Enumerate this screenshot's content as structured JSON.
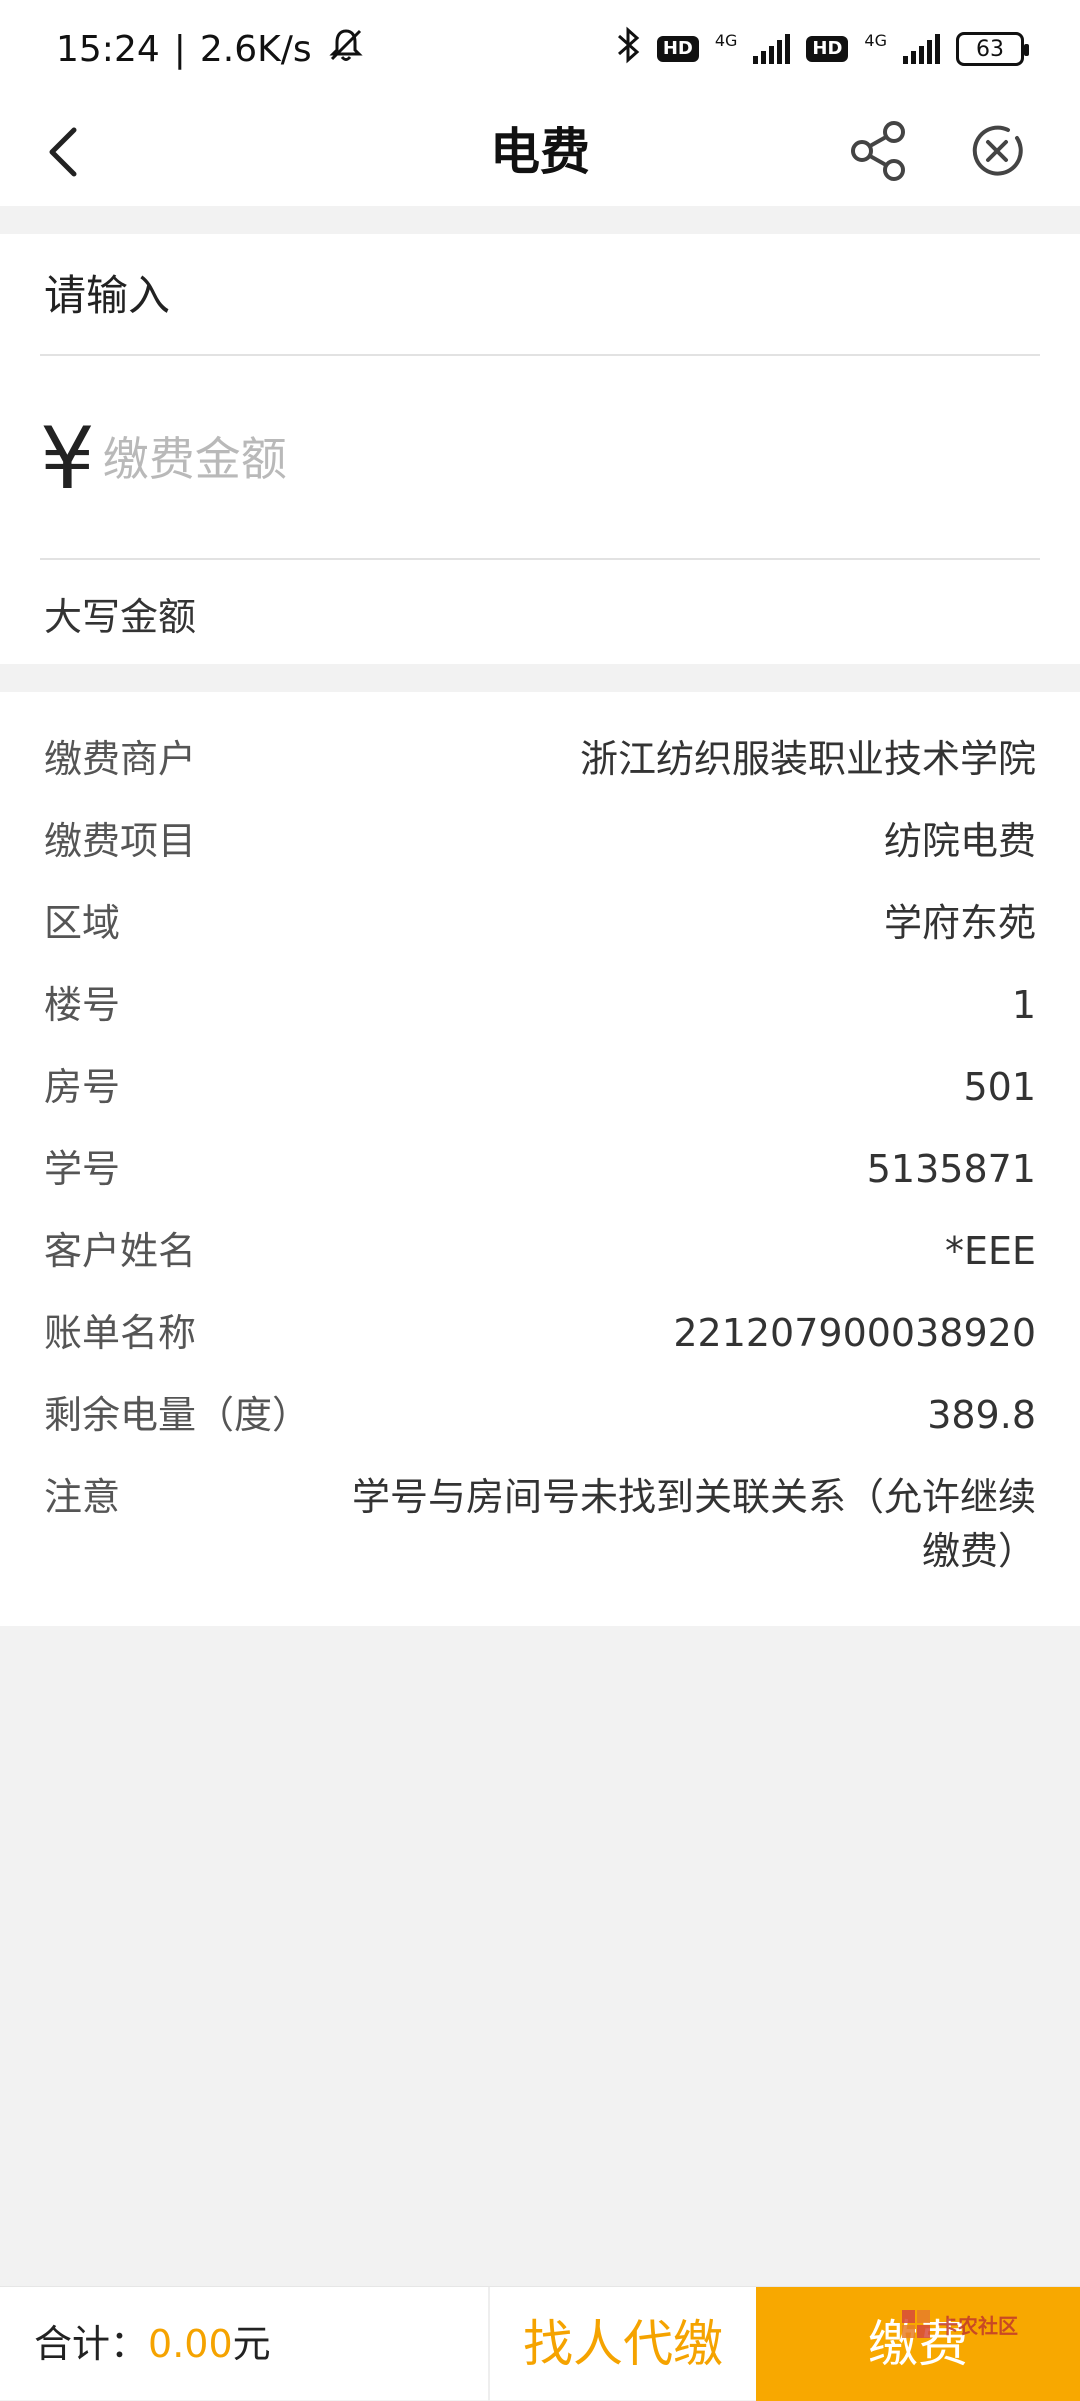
{
  "status_bar": {
    "time": "15:24",
    "net_speed": "2.6K/s",
    "hd1": "HD",
    "net1": "4G",
    "hd2": "HD",
    "net2": "4G",
    "battery": "63"
  },
  "header": {
    "title": "电费"
  },
  "input": {
    "prompt": "请输入",
    "currency_symbol": "¥",
    "amount_placeholder": "缴费金额",
    "uppercase_label": "大写金额"
  },
  "info": {
    "rows": [
      {
        "label": "缴费商户",
        "value": "浙江纺织服装职业技术学院"
      },
      {
        "label": "缴费项目",
        "value": "纺院电费"
      },
      {
        "label": "区域",
        "value": "学府东苑"
      },
      {
        "label": "楼号",
        "value": "1"
      },
      {
        "label": "房号",
        "value": "501"
      },
      {
        "label": "学号",
        "value": "5135871"
      },
      {
        "label": "客户姓名",
        "value": "*EEE"
      },
      {
        "label": "账单名称",
        "value": "221207900038920"
      },
      {
        "label": "剩余电量（度）",
        "value": "389.8"
      },
      {
        "label": "注意",
        "value": "学号与房间号未找到关联关系（允许继续缴费）"
      }
    ]
  },
  "bottom": {
    "total_label": "合计：",
    "total_amount": "0.00",
    "total_unit": "元",
    "proxy_pay_label": "找人代缴",
    "pay_label": "缴费"
  },
  "watermark": {
    "text": "卡农社区"
  },
  "colors": {
    "accent": "#f8a800",
    "accent_text": "#f5a300"
  }
}
